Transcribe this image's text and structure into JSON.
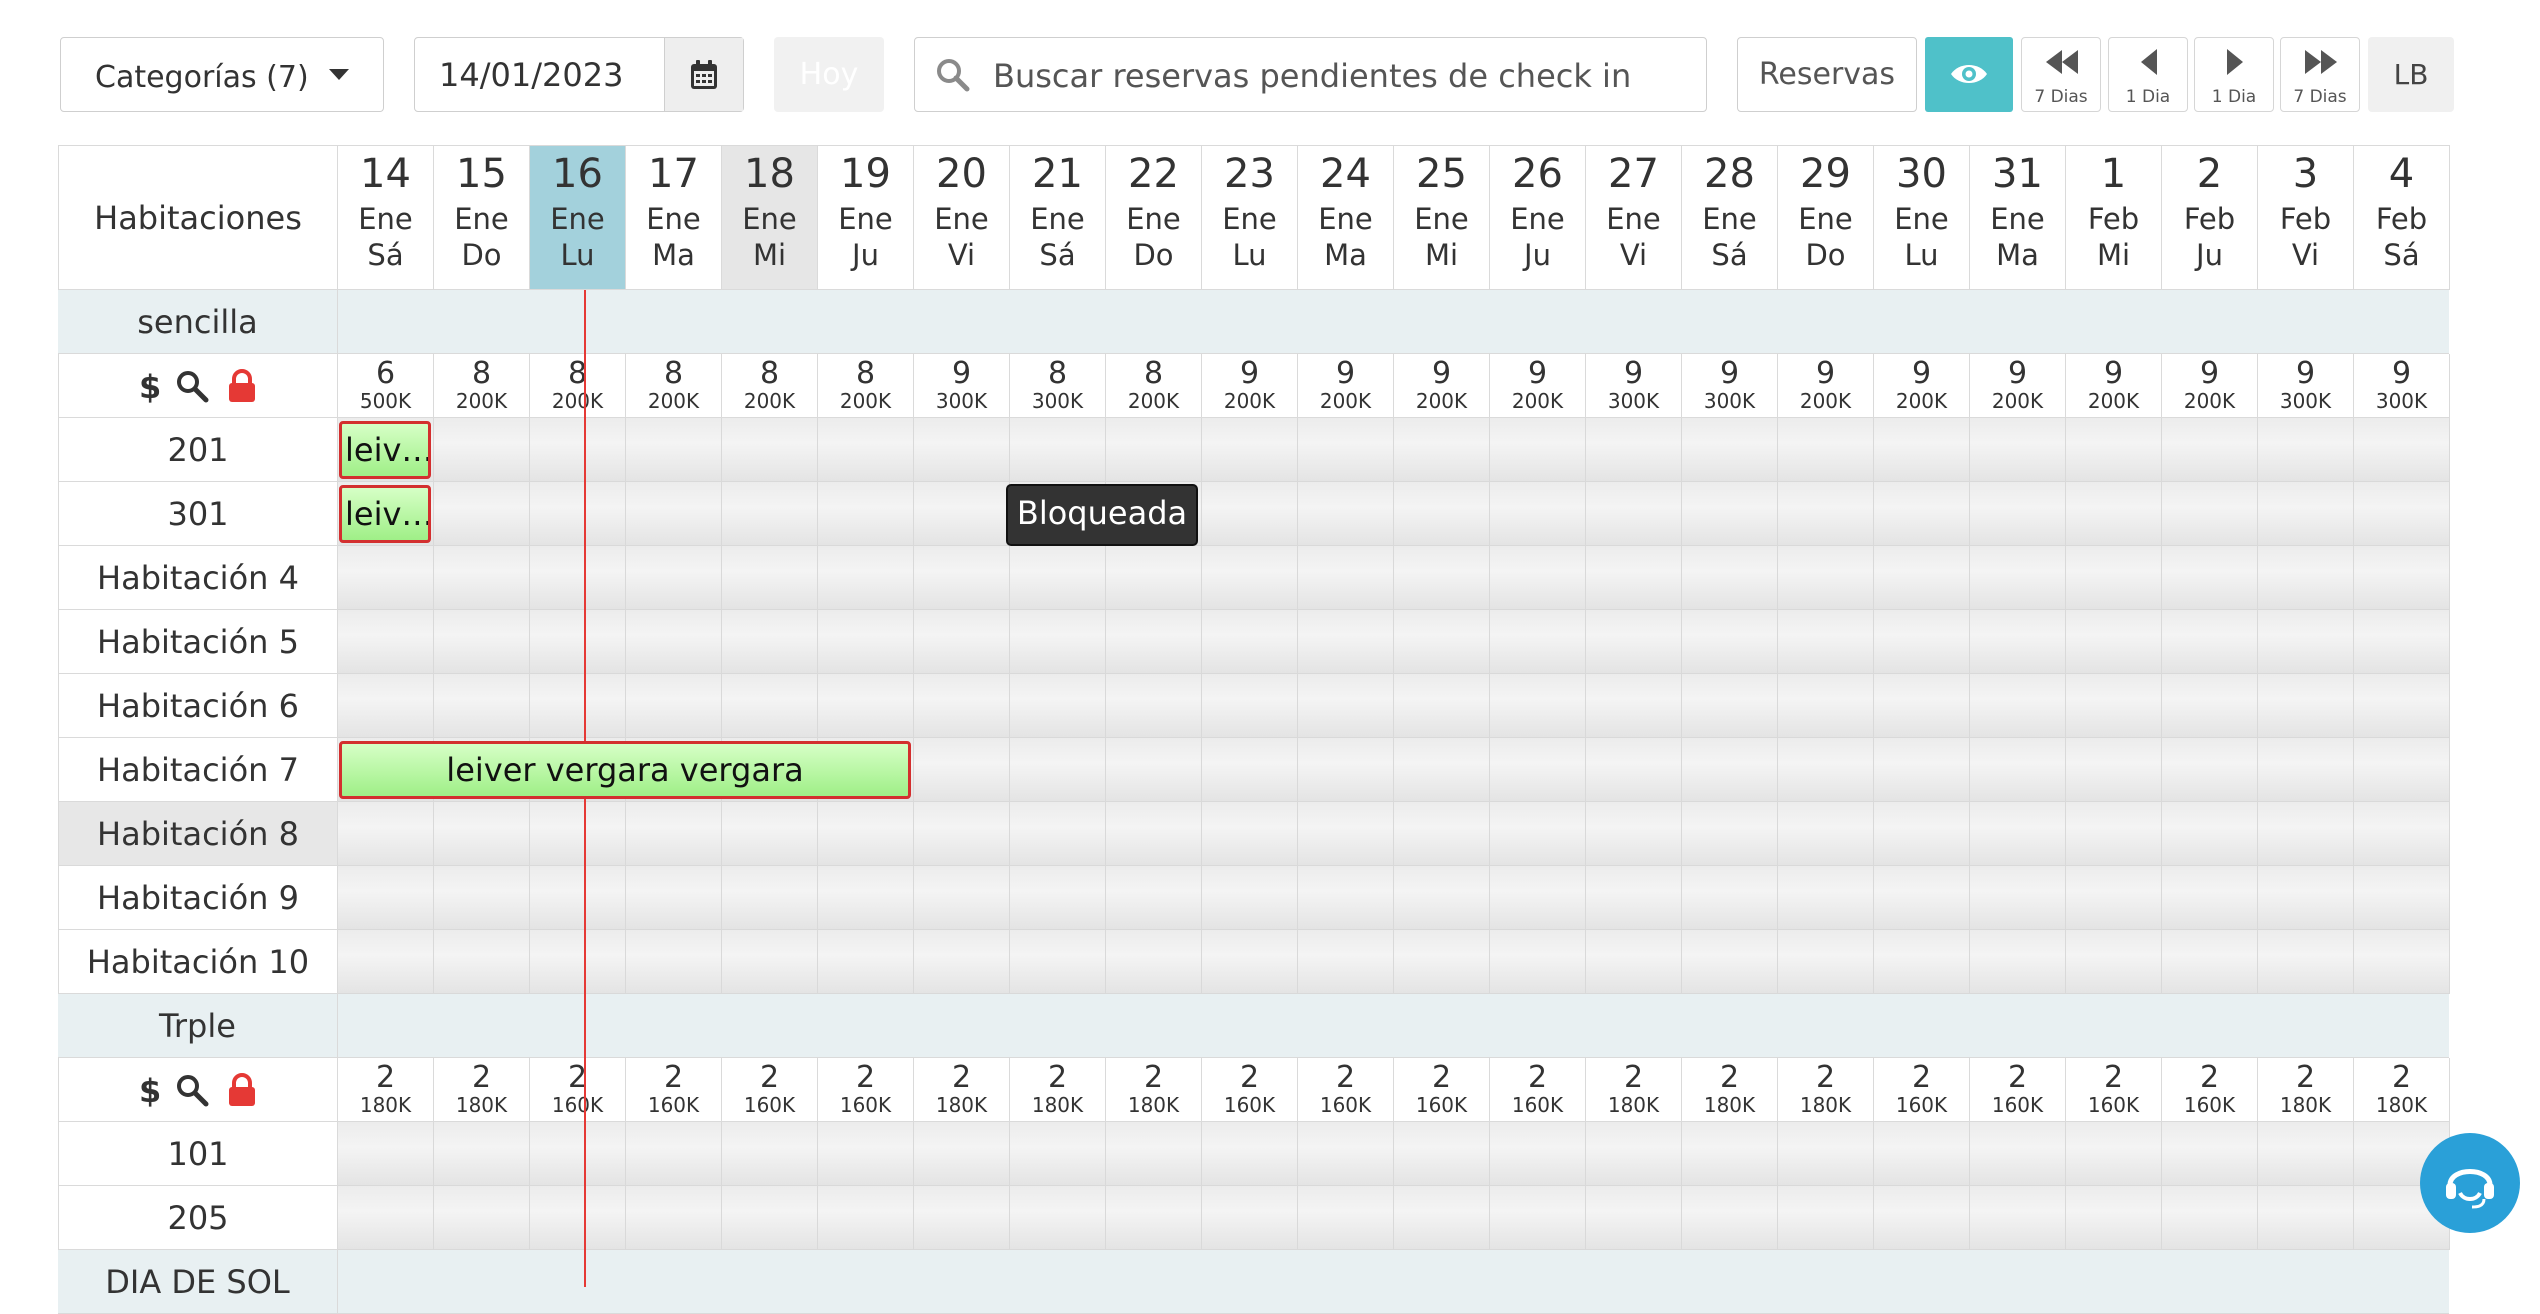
{
  "toolbar": {
    "category_select": "Categorías (7)",
    "date_value": "14/01/2023",
    "hoy_label": "Hoy",
    "search_placeholder": "Buscar reservas pendientes de check in",
    "reservas_label": "Reservas",
    "nav_back_7": "7 Dias",
    "nav_back_1": "1 Dia",
    "nav_fwd_1": "1 Dia",
    "nav_fwd_7": "7 Dias",
    "lb_label": "LB"
  },
  "grid": {
    "rooms_header": "Habitaciones",
    "days": [
      {
        "n": "14",
        "m": "Ene",
        "w": "Sá"
      },
      {
        "n": "15",
        "m": "Ene",
        "w": "Do"
      },
      {
        "n": "16",
        "m": "Ene",
        "w": "Lu"
      },
      {
        "n": "17",
        "m": "Ene",
        "w": "Ma"
      },
      {
        "n": "18",
        "m": "Ene",
        "w": "Mi"
      },
      {
        "n": "19",
        "m": "Ene",
        "w": "Ju"
      },
      {
        "n": "20",
        "m": "Ene",
        "w": "Vi"
      },
      {
        "n": "21",
        "m": "Ene",
        "w": "Sá"
      },
      {
        "n": "22",
        "m": "Ene",
        "w": "Do"
      },
      {
        "n": "23",
        "m": "Ene",
        "w": "Lu"
      },
      {
        "n": "24",
        "m": "Ene",
        "w": "Ma"
      },
      {
        "n": "25",
        "m": "Ene",
        "w": "Mi"
      },
      {
        "n": "26",
        "m": "Ene",
        "w": "Ju"
      },
      {
        "n": "27",
        "m": "Ene",
        "w": "Vi"
      },
      {
        "n": "28",
        "m": "Ene",
        "w": "Sá"
      },
      {
        "n": "29",
        "m": "Ene",
        "w": "Do"
      },
      {
        "n": "30",
        "m": "Ene",
        "w": "Lu"
      },
      {
        "n": "31",
        "m": "Ene",
        "w": "Ma"
      },
      {
        "n": "1",
        "m": "Feb",
        "w": "Mi"
      },
      {
        "n": "2",
        "m": "Feb",
        "w": "Ju"
      },
      {
        "n": "3",
        "m": "Feb",
        "w": "Vi"
      },
      {
        "n": "4",
        "m": "Feb",
        "w": "Sá"
      }
    ],
    "sections": [
      {
        "name": "sencilla",
        "avail": [
          "6",
          "8",
          "8",
          "8",
          "8",
          "8",
          "9",
          "8",
          "8",
          "9",
          "9",
          "9",
          "9",
          "9",
          "9",
          "9",
          "9",
          "9",
          "9",
          "9",
          "9",
          "9"
        ],
        "prices": [
          "500K",
          "200K",
          "200K",
          "200K",
          "200K",
          "200K",
          "300K",
          "300K",
          "200K",
          "200K",
          "200K",
          "200K",
          "200K",
          "300K",
          "300K",
          "200K",
          "200K",
          "200K",
          "200K",
          "200K",
          "300K",
          "300K"
        ],
        "rooms": [
          "201",
          "301",
          "Habitación 4",
          "Habitación 5",
          "Habitación 6",
          "Habitación 7",
          "Habitación 8",
          "Habitación 9",
          "Habitación 10"
        ]
      },
      {
        "name": "Trple",
        "avail": [
          "2",
          "2",
          "2",
          "2",
          "2",
          "2",
          "2",
          "2",
          "2",
          "2",
          "2",
          "2",
          "2",
          "2",
          "2",
          "2",
          "2",
          "2",
          "2",
          "2",
          "2",
          "2"
        ],
        "prices": [
          "180K",
          "180K",
          "160K",
          "160K",
          "160K",
          "160K",
          "180K",
          "180K",
          "180K",
          "160K",
          "160K",
          "160K",
          "160K",
          "180K",
          "180K",
          "180K",
          "160K",
          "160K",
          "160K",
          "160K",
          "180K",
          "180K"
        ],
        "rooms": [
          "101",
          "205"
        ]
      },
      {
        "name": "DIA DE SOL",
        "avail": [],
        "prices": [],
        "rooms": []
      }
    ],
    "bookings": [
      {
        "room": "201",
        "label": "leiv…"
      },
      {
        "room": "301",
        "label": "leiv…"
      },
      {
        "room": "Habitación 7",
        "label": "leiver vergara vergara"
      }
    ],
    "blocked": {
      "room": "301",
      "label": "Bloqueada"
    }
  },
  "colors": {
    "accent": "#4fc1c9",
    "today_column": "#a3d1dc",
    "booking_border": "#d32f2f",
    "booking_fill": "#b5f59f",
    "lock": "#e53935",
    "support": "#2aa0d8"
  }
}
